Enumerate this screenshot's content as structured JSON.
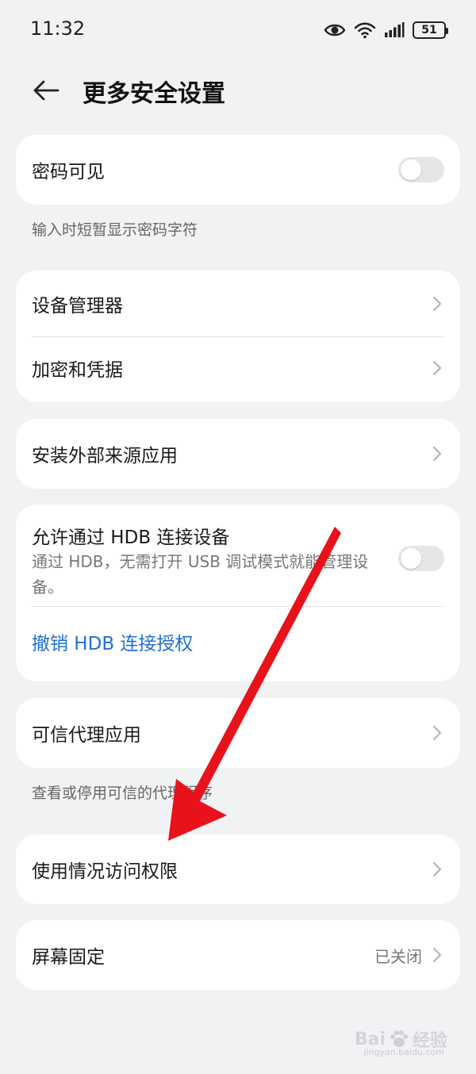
{
  "status_bar": {
    "time": "11:32",
    "battery_level": "51",
    "icons": [
      "eye-icon",
      "wifi-icon",
      "signal-icon",
      "battery-icon"
    ]
  },
  "header": {
    "title": "更多安全设置",
    "back_icon": "arrow-left-icon"
  },
  "password_visible": {
    "label": "密码可见",
    "enabled": false,
    "caption": "输入时短暂显示密码字符"
  },
  "device_group": {
    "items": [
      {
        "label": "设备管理器"
      },
      {
        "label": "加密和凭据"
      }
    ]
  },
  "external_apps": {
    "label": "安装外部来源应用"
  },
  "hdb": {
    "title": "允许通过 HDB 连接设备",
    "description": "通过 HDB，无需打开 USB 调试模式就能管理设备。",
    "enabled": false,
    "revoke_label": "撤销 HDB 连接授权"
  },
  "trust_agents": {
    "label": "可信代理应用",
    "caption": "查看或停用可信的代理程序"
  },
  "usage_access": {
    "label": "使用情况访问权限"
  },
  "screen_pinning": {
    "label": "屏幕固定",
    "value": "已关闭"
  },
  "watermark": {
    "text": "Bai",
    "suffix": "经验",
    "sub": "jingyan.baidu.com"
  },
  "colors": {
    "background": "#f1f2f4",
    "card": "#ffffff",
    "link": "#1f6fd6",
    "annotation_arrow": "#e8121b"
  }
}
